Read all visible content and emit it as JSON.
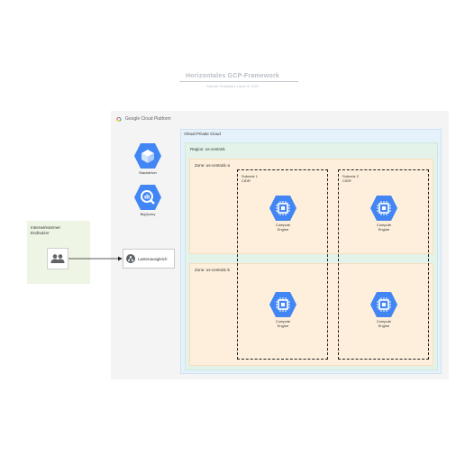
{
  "header": {
    "title": "Horizontales GCP-Framework",
    "subtitle": "Gartner Templates  |  April 3, 2020"
  },
  "platform": {
    "label": "Google Cloud Platform"
  },
  "services": [
    {
      "name": "Stackdriver",
      "icon": "stackdriver-icon"
    },
    {
      "name": "BigQuery",
      "icon": "bigquery-icon"
    }
  ],
  "vpc": {
    "label": "Virtual Private Cloud"
  },
  "region": {
    "label": "Region: us-central1"
  },
  "zones": [
    {
      "label": "Zone: us-central1-a"
    },
    {
      "label": "Zone: us-central1-b"
    }
  ],
  "subnets": [
    {
      "name": "Subnetz 1",
      "cidr": "CIDR"
    },
    {
      "name": "Subnetz 2",
      "cidr": "CIDR"
    }
  ],
  "compute_engines": [
    {
      "label_line1": "Compute",
      "label_line2": "Engine"
    },
    {
      "label_line1": "Compute",
      "label_line2": "Engine"
    },
    {
      "label_line1": "Compute",
      "label_line2": "Engine"
    },
    {
      "label_line1": "Compute",
      "label_line2": "Engine"
    }
  ],
  "internet": {
    "label_line1": "Internet/externer",
    "label_line2": "Endnutzer",
    "icon": "users-icon"
  },
  "load_balancer": {
    "label": "Lastenausgleich",
    "icon": "load-balancer-icon"
  },
  "colors": {
    "gcp_blue": "#4285f4",
    "vpc_bg": "#e6f2fb",
    "region_bg": "#e3f3ea",
    "zone_bg": "#fdefdb",
    "internet_bg": "#eef5e5"
  }
}
